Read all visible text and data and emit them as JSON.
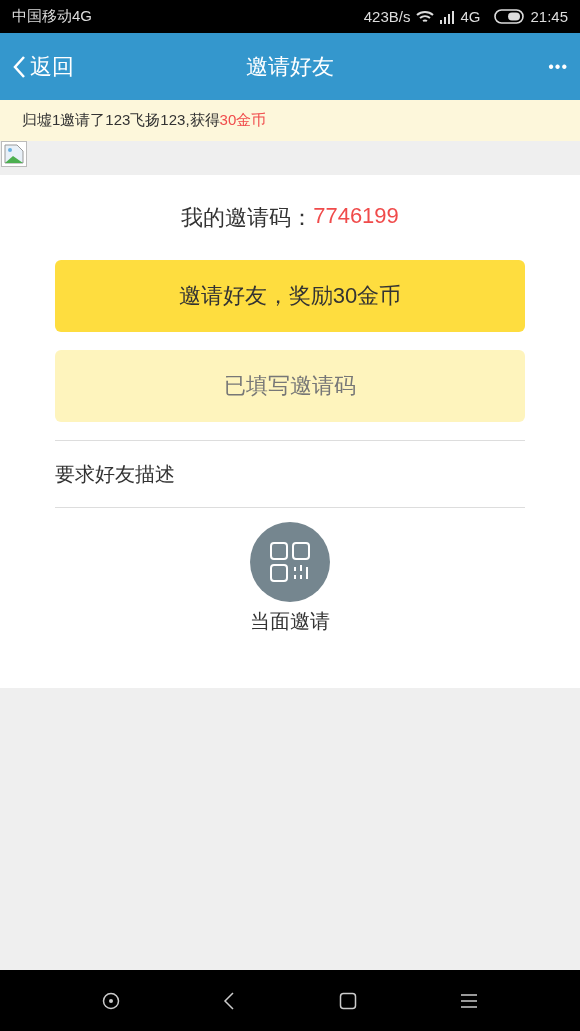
{
  "status_bar": {
    "carrier": "中国移动4G",
    "speed": "423B/s",
    "network": "4G",
    "time": "21:45"
  },
  "header": {
    "back": "返回",
    "title": "邀请好友",
    "more": "•••"
  },
  "notice": {
    "text": "归墟1邀请了123飞扬123,获得",
    "highlight": "30金币"
  },
  "invite_code": {
    "label": "我的邀请码：",
    "value": "7746199"
  },
  "buttons": [
    {
      "label": "邀请好友，奖励30金币",
      "kind": "primary"
    },
    {
      "label": "已填写邀请码",
      "kind": "done"
    }
  ],
  "description": "要求好友描述",
  "face_to_face": {
    "label": "当面邀请"
  }
}
